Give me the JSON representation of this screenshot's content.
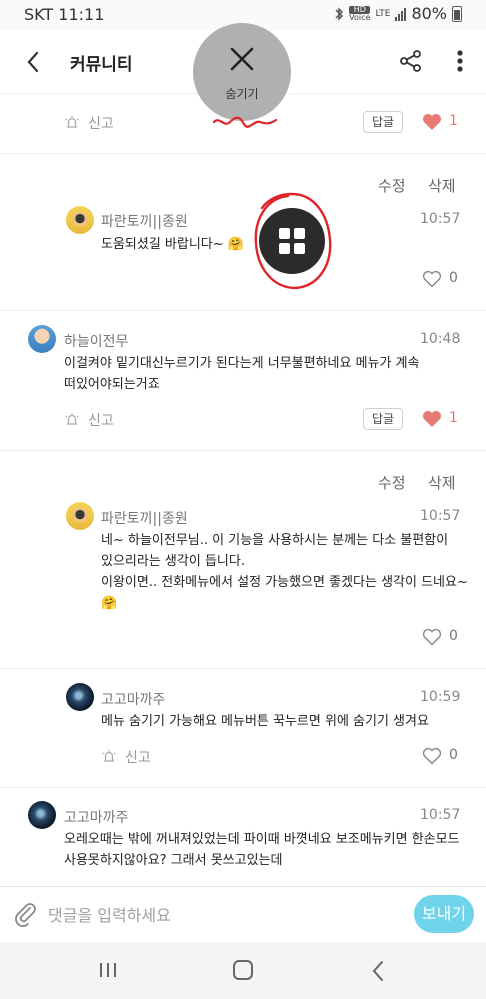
{
  "status_bar": {
    "carrier_time": "SKT 11:11",
    "hd_label": "HD",
    "voice_label": "Voice",
    "lte_label": "LTE",
    "battery": "80%"
  },
  "app_bar": {
    "title": "커뮤니티",
    "icons": [
      "back-arrow-icon",
      "share-icon",
      "more-vertical-icon"
    ]
  },
  "overlay": {
    "hide_label": "숨기기",
    "close_icon": "close-icon",
    "fab_icon": "grid-icon"
  },
  "comments": [
    {
      "report_label": "신고",
      "reply_label": "답글",
      "likes": "1",
      "liked": true
    },
    {
      "edit_label": "수정",
      "delete_label": "삭제",
      "name": "파란토끼||종원",
      "time": "10:57",
      "text_lines": [
        "도움되셨길 바랍니다~ 🤗"
      ],
      "likes": "0",
      "liked": false
    },
    {
      "name": "하늘이전무",
      "time": "10:48",
      "text_lines": [
        "이걸켜야 밑기대신누르기가 된다는게 너무불편하네요 메뉴가 계속",
        "떠있어야되는거죠"
      ],
      "report_label": "신고",
      "reply_label": "답글",
      "likes": "1",
      "liked": true
    },
    {
      "edit_label": "수정",
      "delete_label": "삭제",
      "name": "파란토끼||종원",
      "time": "10:57",
      "text_lines": [
        "네~ 하늘이전무님.. 이 기능을 사용하시는 분께는 다소 불편함이",
        "있으리라는 생각이 듭니다.",
        "이왕이면.. 전화메뉴에서 설정 가능했으면 좋겠다는 생각이 드네요~",
        "🤗"
      ],
      "likes": "0",
      "liked": false
    },
    {
      "name": "고고마까주",
      "time": "10:59",
      "text_lines": [
        "메뉴 숨기기 가능해요  메뉴버튼 꾹누르면 위에 숨기기 생겨요"
      ],
      "report_label": "신고",
      "likes": "0",
      "liked": false
    },
    {
      "name": "고고마까주",
      "time": "10:57",
      "text_lines": [
        "오레오때는 밖에 꺼내져있었는데 파이때 바꼇네요 보조메뉴키면 한손모드",
        "사용못하지않아요? 그래서 못쓰고있는데"
      ]
    }
  ],
  "input_bar": {
    "placeholder": "댓글을 입력하세요",
    "send_label": "보내기",
    "attach_icon": "paperclip-icon"
  },
  "nav_bar": {
    "icons": [
      "recents-icon",
      "home-icon",
      "back-icon"
    ]
  },
  "colors": {
    "accent": "#6fd3ea",
    "heart": "#e67b74",
    "annotation_red": "#e0252a"
  }
}
